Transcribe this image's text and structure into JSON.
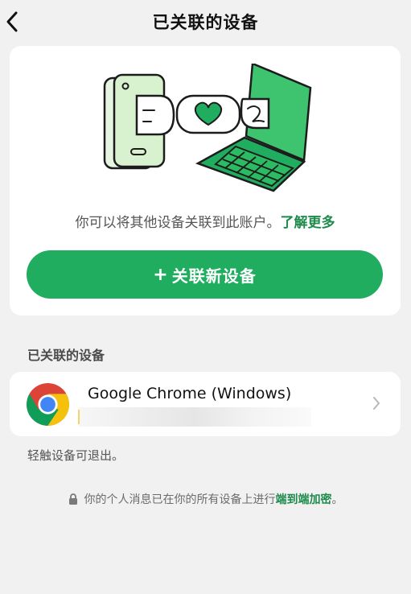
{
  "header": {
    "title": "已关联的设备",
    "back_icon": "chevron-left-icon"
  },
  "intro": {
    "text": "你可以将其他设备关联到此账户。",
    "learn_more": "了解更多"
  },
  "link_button": {
    "plus": "+",
    "label": "关联新设备"
  },
  "section": {
    "title": "已关联的设备"
  },
  "devices": [
    {
      "name": "Google Chrome (Windows)",
      "icon": "chrome-icon"
    }
  ],
  "hint": "轻触设备可退出。",
  "footer": {
    "text": "你的个人消息已在你的所有设备上进行",
    "link": "端到端加密",
    "period": "。"
  },
  "colors": {
    "accent": "#21ad5f",
    "link": "#1e8a4b",
    "background": "#f1f1f1"
  }
}
